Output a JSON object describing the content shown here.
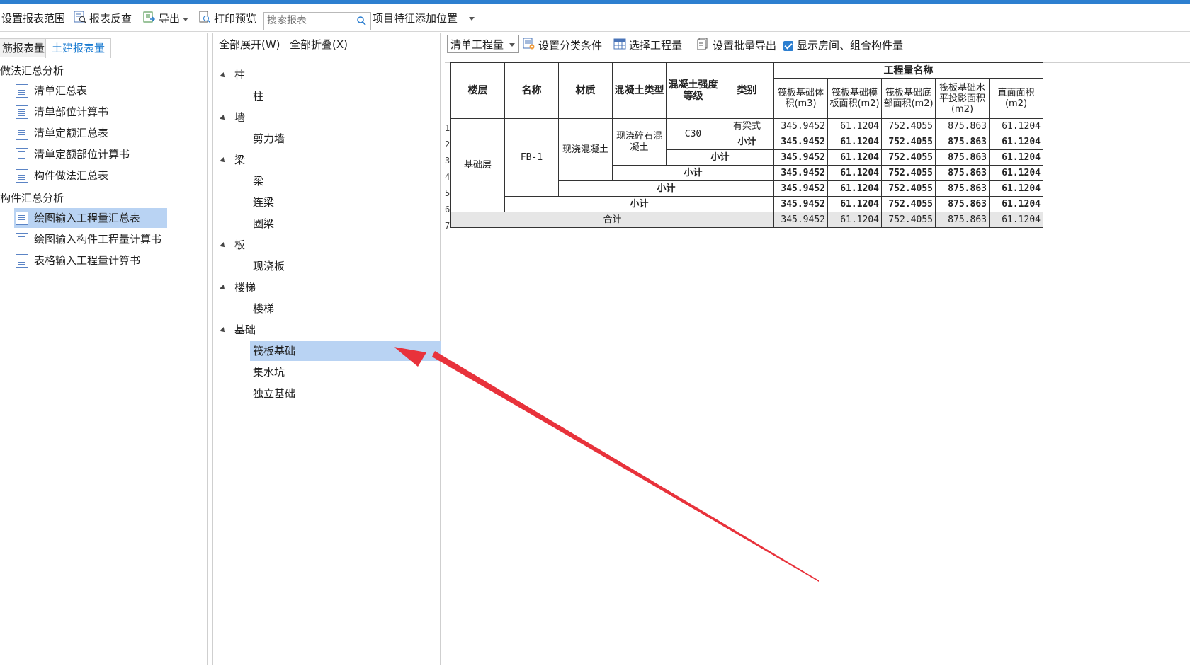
{
  "toolbar": {
    "set_range": "设置报表范围",
    "report_check": "报表反查",
    "export": "导出",
    "print_preview": "打印预览",
    "search_placeholder": "搜索报表",
    "feature_position": "项目特征添加位置"
  },
  "left": {
    "tab_1": "筋报表量",
    "tab_2": "土建报表量",
    "group_1": "做法汇总分析",
    "group_1_items": [
      "清单汇总表",
      "清单部位计算书",
      "清单定额汇总表",
      "清单定额部位计算书",
      "构件做法汇总表"
    ],
    "group_2": "构件汇总分析",
    "group_2_items": [
      "绘图输入工程量汇总表",
      "绘图输入构件工程量计算书",
      "表格输入工程量计算书"
    ]
  },
  "middle": {
    "expand_all": "全部展开(W)",
    "collapse_all": "全部折叠(X)",
    "tree": [
      {
        "name": "柱",
        "children": [
          "柱"
        ]
      },
      {
        "name": "墙",
        "children": [
          "剪力墙"
        ]
      },
      {
        "name": "梁",
        "children": [
          "梁",
          "连梁",
          "圈梁"
        ]
      },
      {
        "name": "板",
        "children": [
          "现浇板"
        ]
      },
      {
        "name": "楼梯",
        "children": [
          "楼梯"
        ]
      },
      {
        "name": "基础",
        "children": [
          "筏板基础",
          "集水坑",
          "独立基础"
        ]
      }
    ]
  },
  "right_toolbar": {
    "combo": "清单工程量",
    "set_category": "设置分类条件",
    "select_quantity": "选择工程量",
    "batch_export": "设置批量导出",
    "show_rooms": "显示房间、组合构件量"
  },
  "report": {
    "headers": {
      "floor": "楼层",
      "name": "名称",
      "material": "材质",
      "concrete_type": "混凝土类型",
      "concrete_grade": "混凝土强度等级",
      "category": "类别",
      "quantity_group": "工程量名称",
      "q1": "筏板基础体积(m3)",
      "q2": "筏板基础模板面积(m2)",
      "q3": "筏板基础底部面积(m2)",
      "q4": "筏板基础水平投影面积(m2)",
      "q5": "直面面积(m2)"
    },
    "row_numbers": [
      "1",
      "2",
      "3",
      "4",
      "5",
      "6",
      "7"
    ],
    "floor": "基础层",
    "name": "FB-1",
    "material": "现浇混凝土",
    "concrete_type": "现浇碎石混凝土",
    "concrete_grade": "C30",
    "category": "有梁式",
    "subtotal_label": "小计",
    "total_label": "合计",
    "values": [
      "345.9452",
      "61.1204",
      "752.4055",
      "875.863",
      "61.1204"
    ]
  },
  "colors": {
    "accent": "#2d7fd0",
    "selection": "#b9d3f3",
    "arrow": "#e8323b"
  }
}
